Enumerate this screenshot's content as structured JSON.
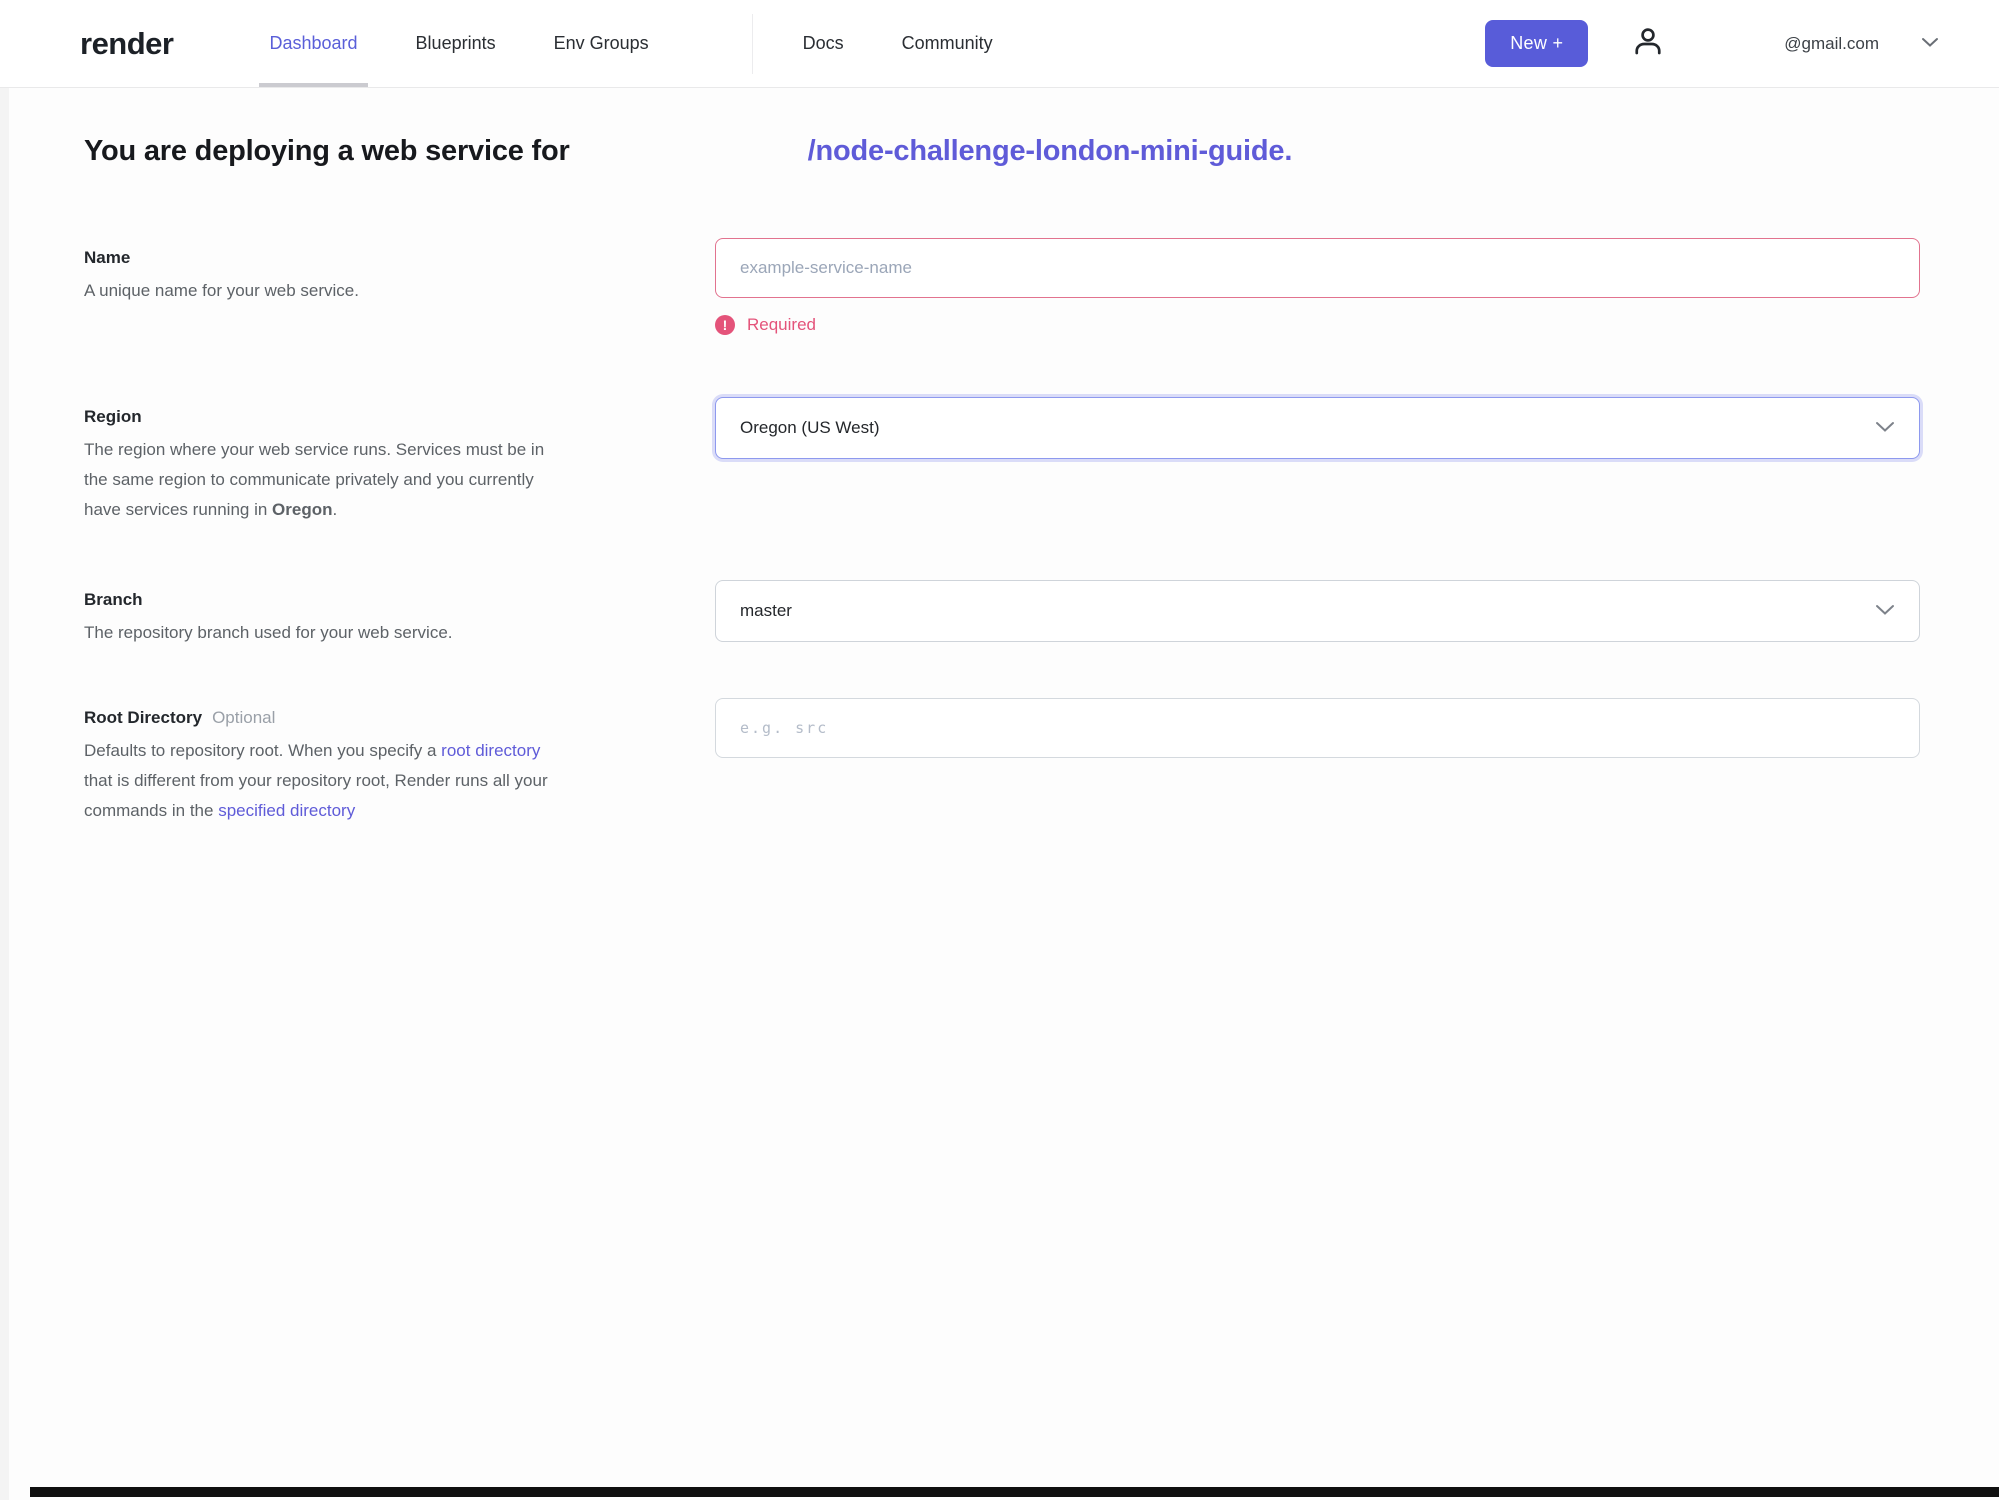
{
  "colors": {
    "accent_purple": "#5a5fd9",
    "link_purple": "#5f5bd8",
    "error_red": "#e4537a",
    "text_dark": "#17191d",
    "text_muted": "#5d6267"
  },
  "header": {
    "logo": "render",
    "nav": [
      {
        "label": "Dashboard",
        "active": true
      },
      {
        "label": "Blueprints",
        "active": false
      },
      {
        "label": "Env Groups",
        "active": false
      },
      {
        "label": "Docs",
        "active": false
      },
      {
        "label": "Community",
        "active": false
      }
    ],
    "new_button_label": "New +",
    "account_email": "@gmail.com"
  },
  "page": {
    "heading_prefix": "You are deploying a web service for",
    "heading_repo": "/node-challenge-london-mini-guide."
  },
  "form": {
    "name": {
      "label": "Name",
      "description": "A unique name for your web service.",
      "placeholder": "example-service-name",
      "error": "Required",
      "error_icon_glyph": "!"
    },
    "region": {
      "label": "Region",
      "description_part1": "The region where your web service runs. Services must be in the same region to communicate privately and you currently have services running in ",
      "description_bold": "Oregon",
      "description_part2": ".",
      "value": "Oregon (US West)"
    },
    "branch": {
      "label": "Branch",
      "description": "The repository branch used for your web service.",
      "value": "master"
    },
    "root_directory": {
      "label": "Root Directory",
      "optional_badge": "Optional",
      "description_part1": "Defaults to repository root. When you specify a ",
      "link1": "root directory",
      "description_part2": " that is different from your repository root, Render runs all your commands in the ",
      "link2": "specified directory"
    }
  }
}
